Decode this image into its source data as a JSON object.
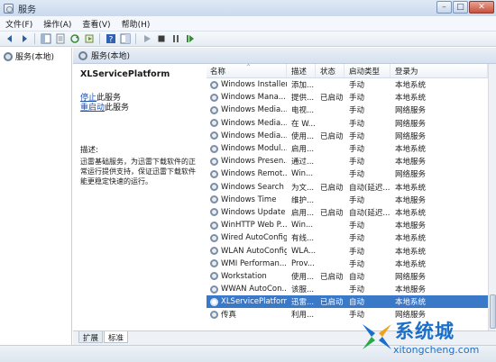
{
  "window": {
    "title": "服务"
  },
  "menu": [
    "文件(F)",
    "操作(A)",
    "查看(V)",
    "帮助(H)"
  ],
  "tree": {
    "root_label": "服务(本地)"
  },
  "panel": {
    "header_label": "服务(本地)"
  },
  "detail": {
    "service_title": "XLServicePlatform",
    "stop_link": "停止",
    "stop_suffix": "此服务",
    "restart_link": "重启动",
    "restart_suffix": "此服务",
    "desc_label": "描述:",
    "desc_text": "迅雷基础服务，为迅雷下载软件的正常运行提供支持，保证迅雷下载软件能更稳定快速的运行。"
  },
  "table": {
    "columns": [
      "名称",
      "描述",
      "状态",
      "启动类型",
      "登录为"
    ],
    "rows": [
      [
        "Windows Installer",
        "添加...",
        "",
        "手动",
        "本地系统"
      ],
      [
        "Windows Mana...",
        "提供...",
        "已启动",
        "手动",
        "本地系统"
      ],
      [
        "Windows Media...",
        "电视...",
        "",
        "手动",
        "网络服务"
      ],
      [
        "Windows Media...",
        "在 W...",
        "",
        "手动",
        "网络服务"
      ],
      [
        "Windows Media...",
        "使用...",
        "已启动",
        "手动",
        "网络服务"
      ],
      [
        "Windows Modul...",
        "启用...",
        "",
        "手动",
        "本地系统"
      ],
      [
        "Windows Presen...",
        "通过...",
        "",
        "手动",
        "本地服务"
      ],
      [
        "Windows Remot...",
        "Win...",
        "",
        "手动",
        "网络服务"
      ],
      [
        "Windows Search",
        "为文...",
        "已启动",
        "自动(延迟...",
        "本地系统"
      ],
      [
        "Windows Time",
        "维护...",
        "",
        "手动",
        "本地服务"
      ],
      [
        "Windows Update",
        "启用...",
        "已启动",
        "自动(延迟...",
        "本地系统"
      ],
      [
        "WinHTTP Web P...",
        "Win...",
        "",
        "手动",
        "本地服务"
      ],
      [
        "Wired AutoConfig",
        "有线...",
        "",
        "手动",
        "本地系统"
      ],
      [
        "WLAN AutoConfig",
        "WLA...",
        "",
        "手动",
        "本地系统"
      ],
      [
        "WMI Performan...",
        "Prov...",
        "",
        "手动",
        "本地系统"
      ],
      [
        "Workstation",
        "使用...",
        "已启动",
        "自动",
        "网络服务"
      ],
      [
        "WWAN AutoCon...",
        "该服...",
        "",
        "手动",
        "本地服务"
      ],
      [
        "XLServicePlatform",
        "迅雷...",
        "已启动",
        "自动",
        "本地系统"
      ],
      [
        "传真",
        "利用...",
        "",
        "手动",
        "网络服务"
      ]
    ],
    "selected_index": 17
  },
  "tabs": [
    "扩展",
    "标准"
  ],
  "watermark": {
    "brand": "系统城",
    "url": "xitongcheng.com"
  }
}
